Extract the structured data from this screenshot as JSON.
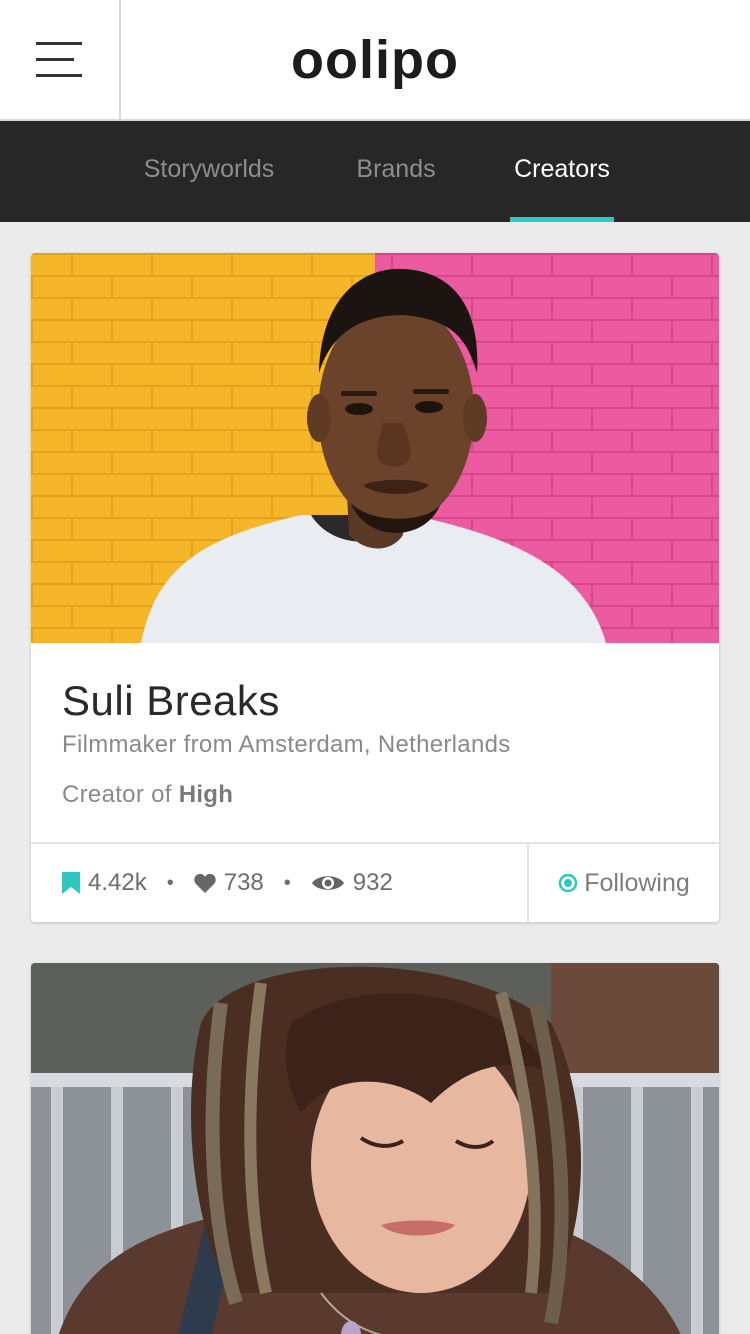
{
  "header": {
    "logo_text": "oolipo",
    "menu_icon": "hamburger-menu-icon"
  },
  "tabs": [
    {
      "label": "Storyworlds",
      "active": false
    },
    {
      "label": "Brands",
      "active": false
    },
    {
      "label": "Creators",
      "active": true
    }
  ],
  "colors": {
    "accent": "#2fc8c0",
    "tab_bar": "#272727",
    "background": "#ebebeb"
  },
  "cards": [
    {
      "name": "Suli Breaks",
      "subtitle": "Filmmaker from Amsterdam, Netherlands",
      "creator_prefix": "Creator of",
      "creator_work": "High",
      "stats": {
        "bookmarks": "4.42k",
        "likes": "738",
        "views": "932"
      },
      "follow_label": "Following"
    }
  ]
}
